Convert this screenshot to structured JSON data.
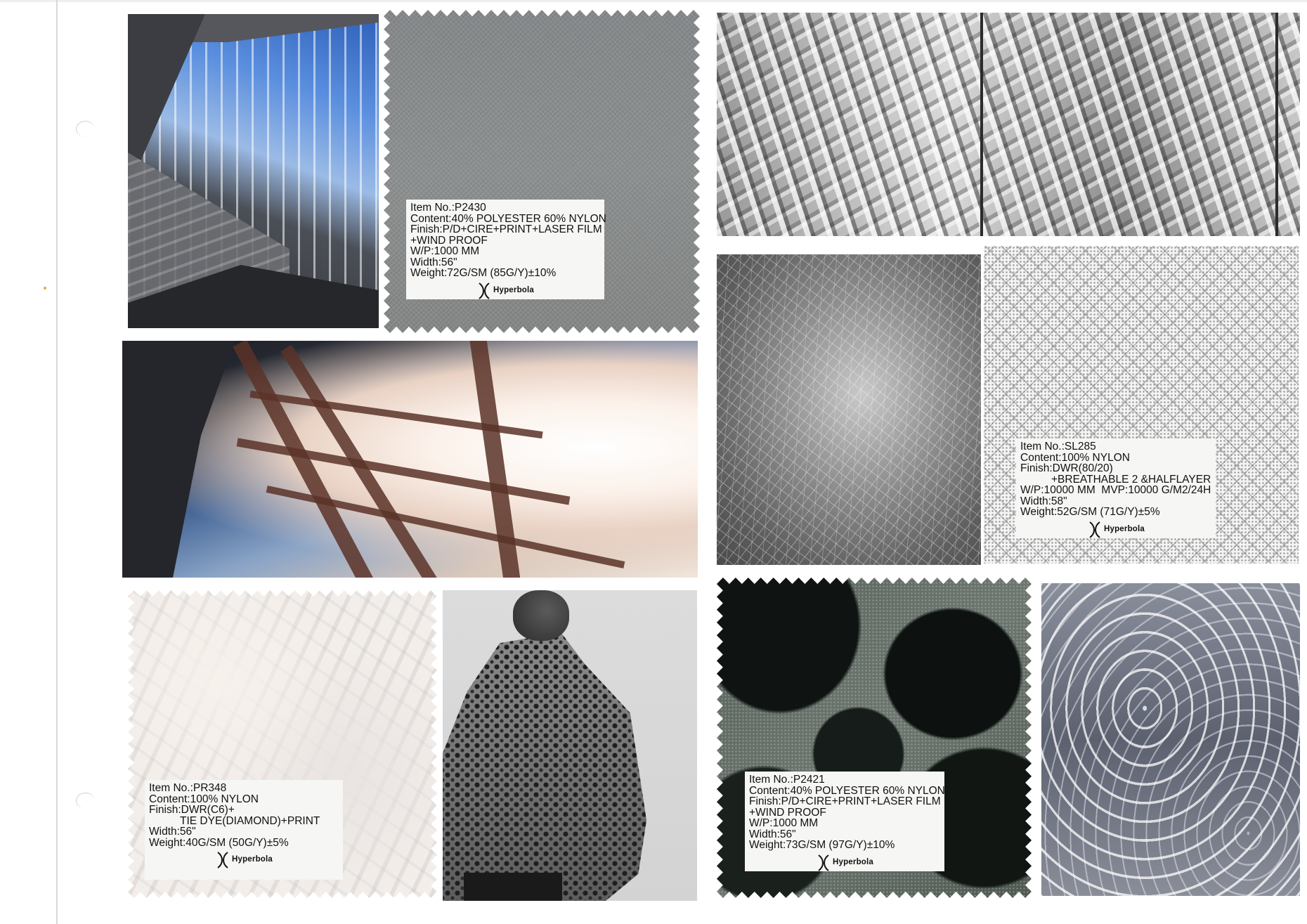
{
  "brand": "Hyperbola",
  "swatches": [
    {
      "lines": [
        "Item No.:P2430",
        "Content:40% POLYESTER 60% NYLON",
        "Finish:P/D+CIRE+PRINT+LASER FILM",
        "+WIND PROOF",
        "W/P:1000 MM",
        "Width:56\"",
        "Weight:72G/SM (85G/Y)±10%"
      ]
    },
    {
      "lines": [
        "Item No.:SL285",
        "Content:100% NYLON",
        "Finish:DWR(80/20)",
        "+BREATHABLE 2 &HALFLAYER",
        "W/P:10000 MM  MVP:10000 G/M2/24H",
        "Width:58\"",
        "Weight:52G/SM (71G/Y)±5%"
      ]
    },
    {
      "lines": [
        "Item No.:PR348",
        "Content:100% NYLON",
        "Finish:DWR(C6)+",
        "TIE DYE(DIAMOND)+PRINT",
        "Width:56\"",
        "Weight:40G/SM (50G/Y)±5%"
      ]
    },
    {
      "lines": [
        "Item No.:P2421",
        "Content:40% POLYESTER 60% NYLON",
        "Finish:P/D+CIRE+PRINT+LASER FILM",
        "+WIND PROOF",
        "W/P:1000 MM",
        "Width:56\"",
        "Weight:73G/SM (97G/Y)±10%"
      ]
    }
  ],
  "colors": {
    "label_bg": "#f6f6f4",
    "page_bg": "#ffffff"
  }
}
